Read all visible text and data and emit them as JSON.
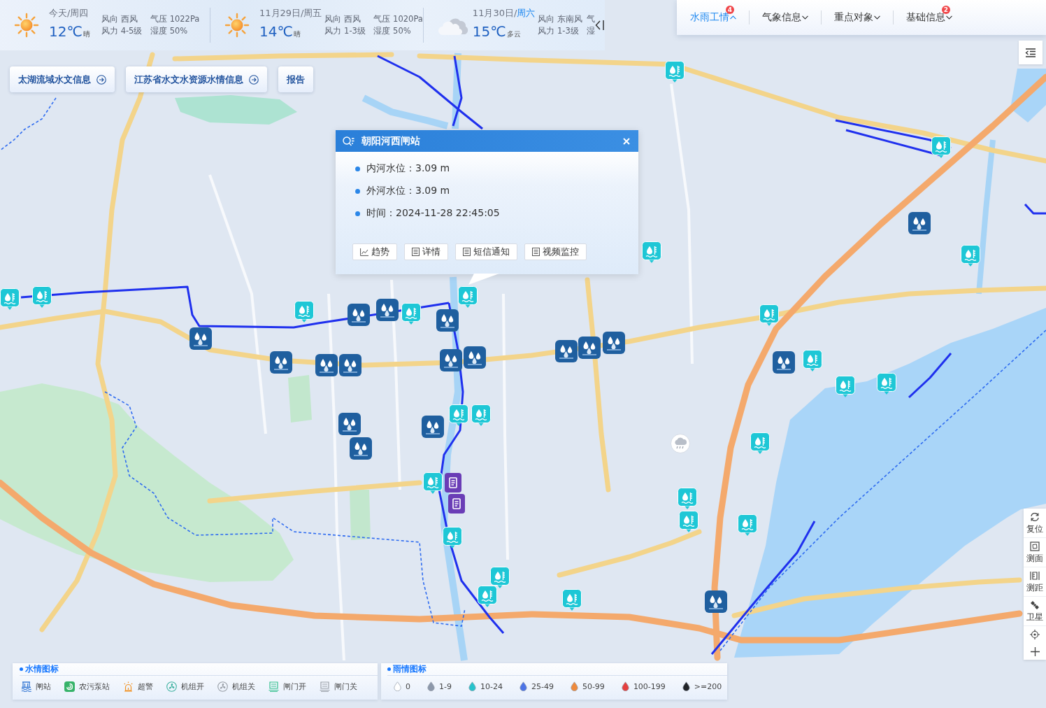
{
  "weather": {
    "days": [
      {
        "date": "今天/",
        "weekday": "周四",
        "weekday_highlighted": false,
        "kind": "sunny",
        "temperature": "12℃",
        "condition": "晴",
        "wind_direction": "风向 西风",
        "wind_force": "风力 4-5级",
        "pressure": "气压 1022Pa",
        "humidity": "湿度 50%"
      },
      {
        "date": "11月29日/",
        "weekday": "周五",
        "weekday_highlighted": false,
        "kind": "sunny",
        "temperature": "14℃",
        "condition": "晴",
        "wind_direction": "风向 西风",
        "wind_force": "风力 1-3级",
        "pressure": "气压 1020Pa",
        "humidity": "湿度 50%"
      },
      {
        "date": "11月30日/",
        "weekday": "周六",
        "weekday_highlighted": true,
        "kind": "cloudy",
        "temperature": "15℃",
        "condition": "多云",
        "wind_direction": "风向 东南风",
        "wind_force": "风力 1-3级",
        "pressure": "气",
        "humidity": "湿"
      }
    ]
  },
  "top_tabs": [
    {
      "label": "水雨工情",
      "selected": true,
      "expanded": true,
      "badge": "4"
    },
    {
      "label": "气象信息",
      "selected": false,
      "expanded": false
    },
    {
      "label": "重点对象",
      "selected": false,
      "expanded": false
    },
    {
      "label": "基础信息",
      "selected": false,
      "expanded": false,
      "badge": "2"
    }
  ],
  "link_buttons": [
    {
      "label": "太湖流域水文信息",
      "arrow": true
    },
    {
      "label": "江苏省水文水资源水情信息",
      "arrow": true
    },
    {
      "label": "报告",
      "arrow": false
    }
  ],
  "popup": {
    "title": "朝阳河西闸站",
    "fields": [
      "内河水位：3.09 m",
      "外河水位：3.09 m",
      "时间：2024-11-28 22:45:05"
    ],
    "actions": [
      {
        "label": "趋势",
        "kind": "chart"
      },
      {
        "label": "详情",
        "kind": "document"
      },
      {
        "label": "短信通知",
        "kind": "document"
      },
      {
        "label": "视频监控",
        "kind": "document"
      }
    ]
  },
  "map_markers": [
    {
      "kind": "water"
    },
    {
      "kind": "water"
    },
    {
      "kind": "rain"
    },
    {
      "kind": "water"
    },
    {
      "kind": "water"
    },
    {
      "kind": "water"
    },
    {
      "kind": "water"
    },
    {
      "kind": "water"
    },
    {
      "kind": "water"
    },
    {
      "kind": "rain"
    },
    {
      "kind": "water"
    },
    {
      "kind": "rain"
    },
    {
      "kind": "water"
    },
    {
      "kind": "rain"
    },
    {
      "kind": "rain"
    },
    {
      "kind": "rain"
    },
    {
      "kind": "rain"
    },
    {
      "kind": "rain"
    },
    {
      "kind": "rain"
    },
    {
      "kind": "rain"
    },
    {
      "kind": "water"
    },
    {
      "kind": "rain"
    },
    {
      "kind": "rain"
    },
    {
      "kind": "rain"
    },
    {
      "kind": "rain"
    },
    {
      "kind": "water"
    },
    {
      "kind": "water"
    },
    {
      "kind": "water"
    },
    {
      "kind": "water"
    },
    {
      "kind": "rain"
    },
    {
      "kind": "rain"
    },
    {
      "kind": "rain"
    },
    {
      "kind": "water"
    },
    {
      "kind": "water"
    },
    {
      "kind": "gate"
    },
    {
      "kind": "water"
    },
    {
      "kind": "water"
    },
    {
      "kind": "gate"
    },
    {
      "kind": "water"
    },
    {
      "kind": "water"
    },
    {
      "kind": "water"
    },
    {
      "kind": "water"
    },
    {
      "kind": "water"
    },
    {
      "kind": "rain"
    }
  ],
  "map_tools": [
    {
      "label": "复位",
      "kind": "reset"
    },
    {
      "label": "测面",
      "kind": "area"
    },
    {
      "label": "测距",
      "kind": "distance"
    },
    {
      "label": "卫星",
      "kind": "satellite"
    }
  ],
  "water_legend": {
    "title": "水情图标",
    "items": [
      {
        "label": "闸站",
        "kind": "gate_station"
      },
      {
        "label": "农污泵站",
        "kind": "sewage_pump"
      },
      {
        "label": "超警",
        "kind": "alarm"
      },
      {
        "label": "机组开",
        "kind": "unit_on"
      },
      {
        "label": "机组关",
        "kind": "unit_off"
      },
      {
        "label": "闸门开",
        "kind": "gate_open"
      },
      {
        "label": "闸门关",
        "kind": "gate_closed"
      }
    ]
  },
  "rain_legend": {
    "title": "雨情图标",
    "items": [
      {
        "label": "0",
        "color": "#ffffff"
      },
      {
        "label": "1-9",
        "color": "#8d98aa"
      },
      {
        "label": "10-24",
        "color": "#27c3cc"
      },
      {
        "label": "25-49",
        "color": "#4d74e6"
      },
      {
        "label": "50-99",
        "color": "#ee8a3c"
      },
      {
        "label": "100-199",
        "color": "#e5403f"
      },
      {
        "label": ">=200",
        "color": "#222428"
      }
    ]
  }
}
